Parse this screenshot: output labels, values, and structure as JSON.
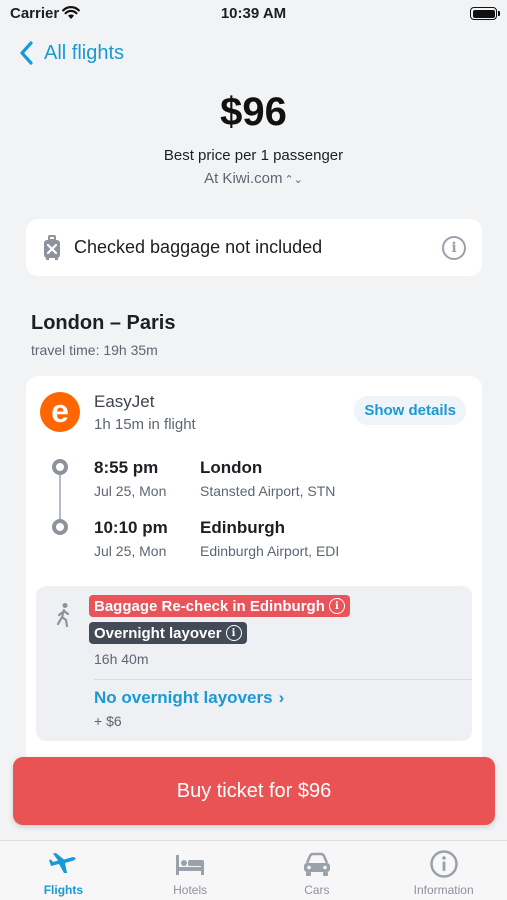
{
  "status_bar": {
    "carrier": "Carrier",
    "time": "10:39 AM"
  },
  "nav": {
    "back_label": "All flights"
  },
  "price": {
    "amount": "$96",
    "subtitle": "Best price per 1 passenger",
    "source": "At Kiwi.com"
  },
  "baggage": {
    "text": "Checked baggage not included"
  },
  "route": {
    "title": "London – Paris",
    "travel_time": "travel time: 19h 35m"
  },
  "flight": {
    "airline": "EasyJet",
    "duration": "1h 15m in flight",
    "details_label": "Show details",
    "departure": {
      "time": "8:55 pm",
      "date": "Jul 25, Mon",
      "city": "London",
      "airport": "Stansted Airport, STN"
    },
    "arrival": {
      "time": "10:10 pm",
      "date": "Jul 25, Mon",
      "city": "Edinburgh",
      "airport": "Edinburgh Airport, EDI"
    }
  },
  "layover": {
    "recheck_tag": "Baggage Re-check in Edinburgh",
    "overnight_tag": "Overnight layover",
    "duration": "16h 40m",
    "alt_link": "No overnight layovers",
    "alt_price": "+ $6"
  },
  "buy_button": {
    "label": "Buy ticket for $96"
  },
  "tabs": [
    {
      "label": "Flights",
      "icon": "plane-icon",
      "active": true
    },
    {
      "label": "Hotels",
      "icon": "bed-icon",
      "active": false
    },
    {
      "label": "Cars",
      "icon": "car-icon",
      "active": false
    },
    {
      "label": "Information",
      "icon": "info-icon",
      "active": false
    }
  ],
  "colors": {
    "accent": "#1a99d6",
    "buy_button": "#e95353",
    "recheck_tag": "#e9535a",
    "overnight_tag": "#434b57",
    "easyjet_orange": "#ff6600"
  }
}
